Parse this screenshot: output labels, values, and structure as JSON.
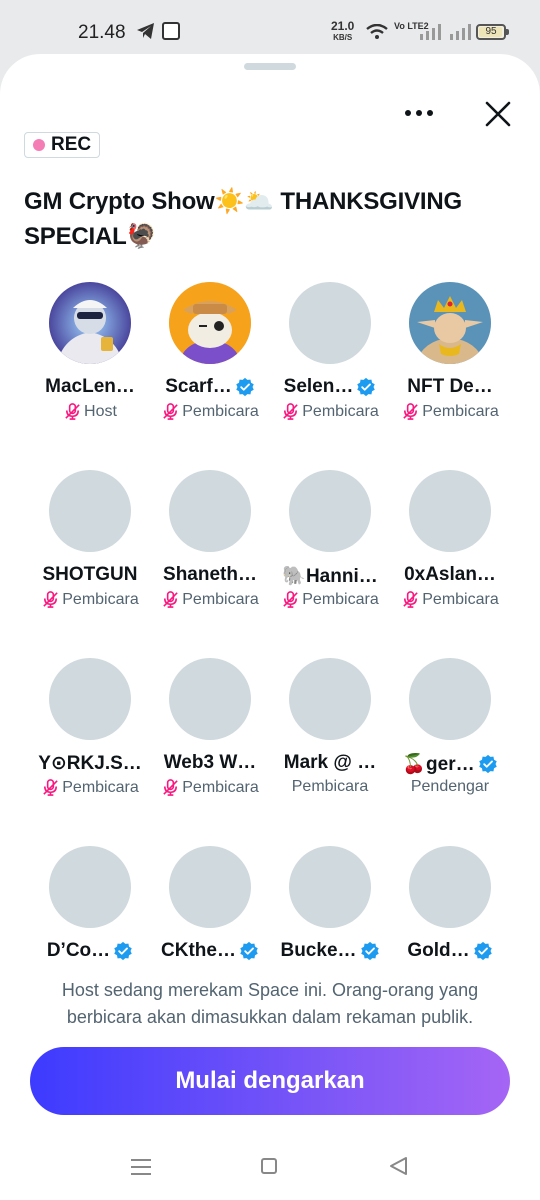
{
  "status_bar": {
    "time": "21.48",
    "net_speed_value": "21.0",
    "net_speed_unit": "KB/S",
    "volte": "Vo LTE2",
    "battery": "95"
  },
  "recording_badge": "REC",
  "space_title": "GM Crypto Show☀️🌥️ THANKSGIVING SPECIAL🦃",
  "participants": [
    {
      "name": "MacLen…",
      "role": "Host",
      "verified": false,
      "muted": true
    },
    {
      "name": "Scarf…",
      "role": "Pembicara",
      "verified": true,
      "muted": true
    },
    {
      "name": "Selen…",
      "role": "Pembicara",
      "verified": true,
      "muted": true
    },
    {
      "name": "NFT De…",
      "role": "Pembicara",
      "verified": false,
      "muted": true
    },
    {
      "name": "SHOTGUN",
      "role": "Pembicara",
      "verified": false,
      "muted": true
    },
    {
      "name": "Shaneth…",
      "role": "Pembicara",
      "verified": false,
      "muted": true
    },
    {
      "name": "🐘Hanni…",
      "role": "Pembicara",
      "verified": false,
      "muted": true
    },
    {
      "name": "0xAslan…",
      "role": "Pembicara",
      "verified": false,
      "muted": true
    },
    {
      "name": "Y⊙RKJ.S…",
      "role": "Pembicara",
      "verified": false,
      "muted": true
    },
    {
      "name": "Web3 W…",
      "role": "Pembicara",
      "verified": false,
      "muted": true
    },
    {
      "name": "Mark @ …",
      "role": "Pembicara",
      "verified": false,
      "muted": false
    },
    {
      "name": "🍒ger…",
      "role": "Pendengar",
      "verified": true,
      "muted": false
    },
    {
      "name": "D’Co…",
      "role": "",
      "verified": true,
      "muted": false
    },
    {
      "name": "CKthe…",
      "role": "",
      "verified": true,
      "muted": false
    },
    {
      "name": "Bucke…",
      "role": "",
      "verified": true,
      "muted": false
    },
    {
      "name": "Gold…",
      "role": "",
      "verified": true,
      "muted": false
    }
  ],
  "recording_notice": "Host sedang merekam Space ini. Orang-orang yang berbicara akan dimasukkan dalam rekaman publik.",
  "listen_button": "Mulai dengarkan",
  "colors": {
    "accent_gradient_start": "#3d3bff",
    "accent_gradient_end": "#a565f5",
    "mute_icon": "#f91880",
    "verified": "#1d9bf0",
    "rec_dot": "#f57db6",
    "avatar_placeholder": "#cfd9de"
  },
  "icons": {
    "more": "more-horizontal-icon",
    "close": "close-icon",
    "muted": "mic-off-icon",
    "verified": "verified-badge-icon"
  }
}
